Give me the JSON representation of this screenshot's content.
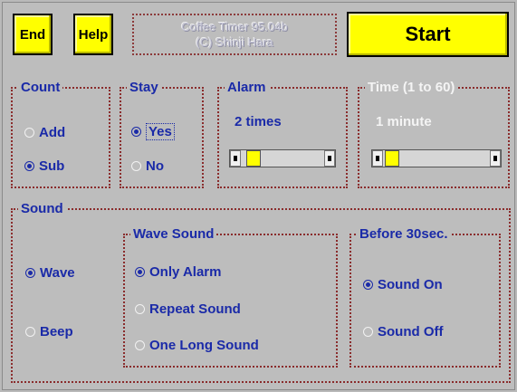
{
  "toolbar": {
    "end_label": "End",
    "help_label": "Help",
    "title_line1": "Coffee Timer 95.04b",
    "title_line2": "(C) Shinji Hara",
    "start_label": "Start"
  },
  "count": {
    "legend": "Count",
    "options": [
      "Add",
      "Sub"
    ],
    "selected": "Sub"
  },
  "stay": {
    "legend": "Stay",
    "options": [
      "Yes",
      "No"
    ],
    "selected": "Yes"
  },
  "alarm": {
    "legend": "Alarm",
    "value_text": "2 times",
    "slider_position": 0.05
  },
  "time": {
    "legend": "Time (1 to 60)",
    "value_text": "1 minute",
    "slider_position": 0.0
  },
  "sound": {
    "legend": "Sound",
    "options": [
      "Wave",
      "Beep"
    ],
    "selected": "Wave"
  },
  "wave_sound": {
    "legend": "Wave Sound",
    "options": [
      "Only Alarm",
      "Repeat Sound",
      "One Long Sound"
    ],
    "selected": "Only Alarm"
  },
  "before_30sec": {
    "legend": "Before 30sec.",
    "options": [
      "Sound On",
      "Sound Off"
    ],
    "selected": "Sound On"
  },
  "colors": {
    "button_yellow": "#ffff00",
    "label_blue": "#1a2aa8",
    "frame_red": "#8a2c2c",
    "background": "#bdbdbd"
  }
}
